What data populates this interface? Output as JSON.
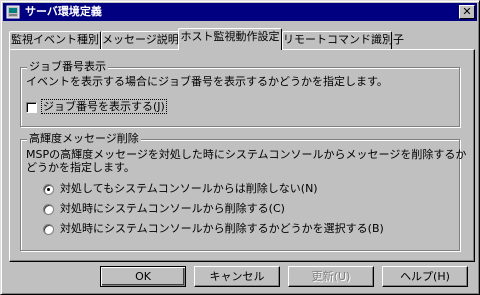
{
  "window": {
    "title": "サーバ環境定義",
    "close_glyph": "✕"
  },
  "tabs": [
    {
      "label": "監視イベント種別",
      "active": false
    },
    {
      "label": "メッセージ説明",
      "active": false
    },
    {
      "label": "ホスト監視動作設定",
      "active": true
    },
    {
      "label": "リモートコマンド識別子",
      "active": false
    }
  ],
  "job_number_group": {
    "title": "ジョブ番号表示",
    "description": "イベントを表示する場合にジョブ番号を表示するかどうかを指定します。",
    "checkbox_label": "ジョブ番号を表示する(J)",
    "checked": false
  },
  "priority_group": {
    "title": "高輝度メッセージ削除",
    "description_line1": "MSPの高輝度メッセージを対処した時にシステムコンソールからメッセージを削除するか",
    "description_line2": "どうかを指定します。",
    "options": [
      {
        "label": "対処してもシステムコンソールからは削除しない(N)",
        "selected": true
      },
      {
        "label": "対処時にシステムコンソールから削除する(C)",
        "selected": false
      },
      {
        "label": "対処時にシステムコンソールから削除するかどうかを選択する(B)",
        "selected": false
      }
    ]
  },
  "buttons": {
    "ok": "OK",
    "cancel": "キャンセル",
    "update": "更新(U)",
    "help": "ヘルプ(H)"
  },
  "colors": {
    "title_bar": "#000080",
    "face": "#c0c0c0"
  },
  "icons": {
    "app": "app-icon",
    "close": "close-icon"
  }
}
